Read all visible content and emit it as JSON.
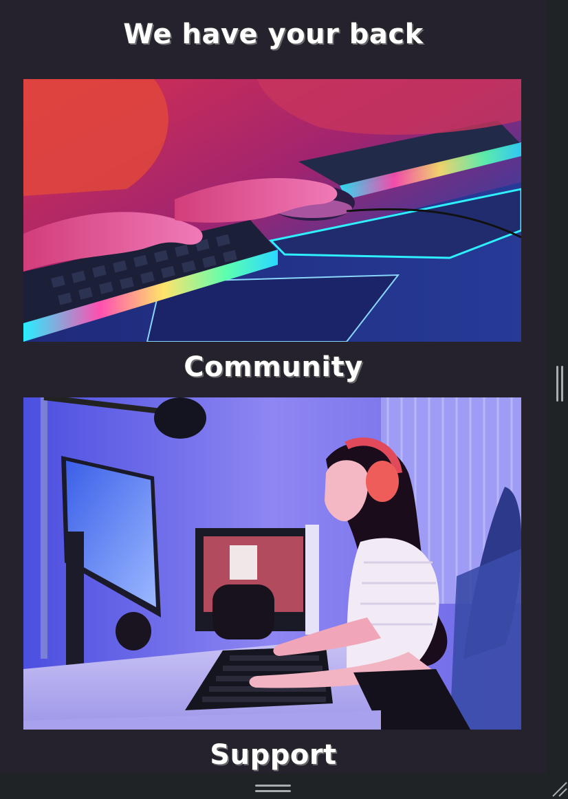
{
  "sections": {
    "main_title": "We have your back",
    "community_title": "Community",
    "support_title": "Support"
  },
  "images": {
    "community_photo": "keyboard-mouse-rgb-photo",
    "support_photo": "gamer-girl-headphones-photo"
  },
  "colors": {
    "page_bg": "#25222e",
    "chrome_bg": "#1f2326",
    "heading_text": "#ffffff"
  }
}
